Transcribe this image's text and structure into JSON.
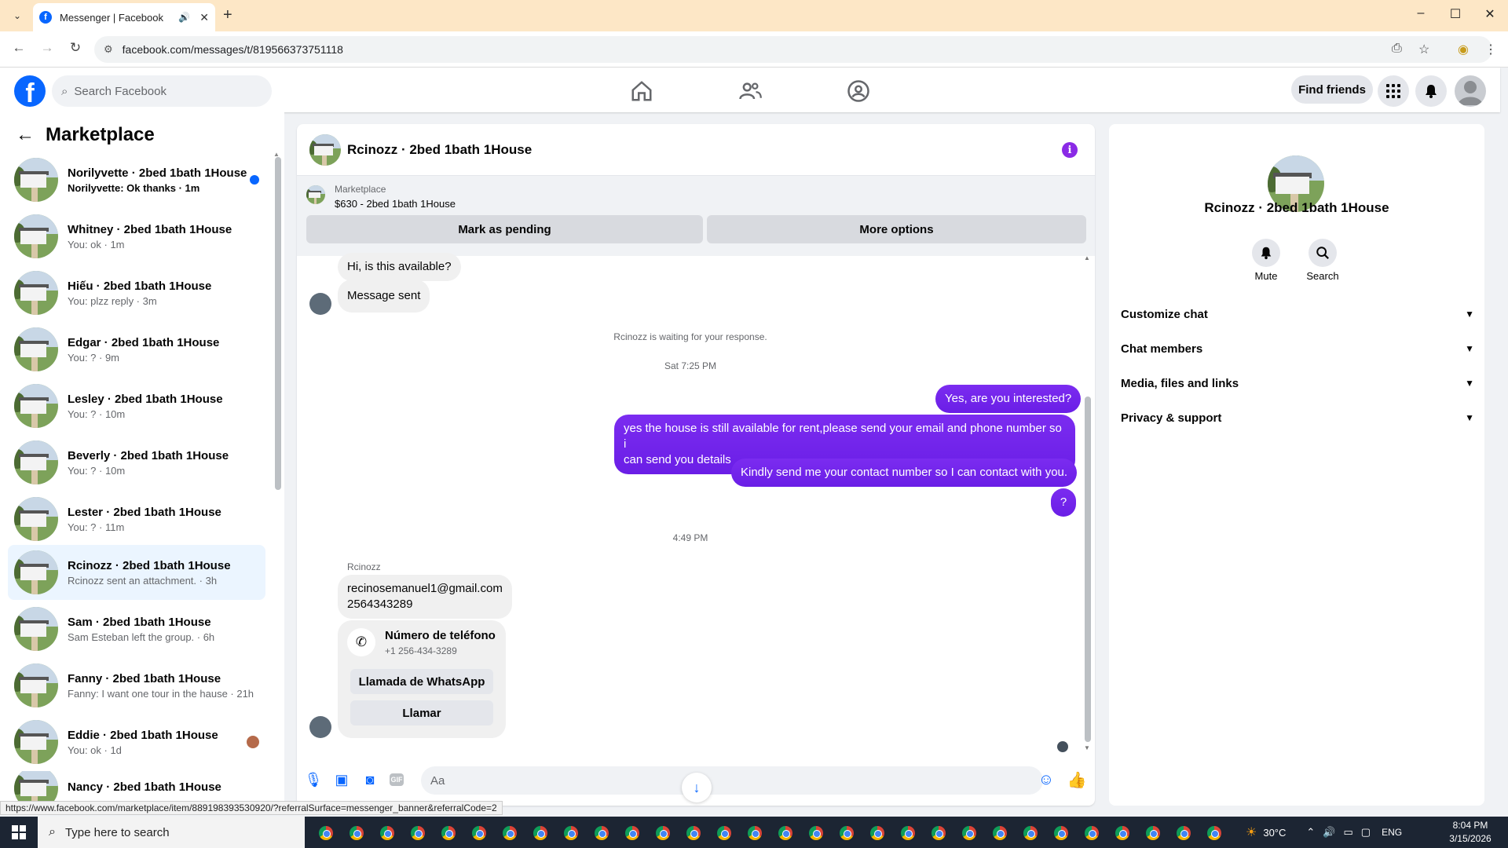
{
  "browser": {
    "tab_title": "Messenger | Facebook",
    "tabs_dropdown": "⌄",
    "new_tab": "+",
    "url": "facebook.com/messages/t/819566373751118",
    "minimize": "–",
    "maximize": "☐",
    "close": "✕",
    "back": "←",
    "forward": "→",
    "reload": "↻"
  },
  "fb_header": {
    "logo": "f",
    "search_placeholder": "Search Facebook",
    "find_friends": "Find friends"
  },
  "sidebar": {
    "title": "Marketplace",
    "back": "←",
    "conversations": [
      {
        "name": "Norilyvette · 2bed 1bath 1House",
        "preview": "Norilyvette: Ok thanks · 1m",
        "unread": true
      },
      {
        "name": "Whitney · 2bed 1bath 1House",
        "preview": "You: ok · 1m"
      },
      {
        "name": "Hiếu · 2bed 1bath 1House",
        "preview": "You: plzz reply · 3m"
      },
      {
        "name": "Edgar · 2bed 1bath 1House",
        "preview": "You: ? · 9m"
      },
      {
        "name": "Lesley · 2bed 1bath 1House",
        "preview": "You: ? · 10m"
      },
      {
        "name": "Beverly · 2bed 1bath 1House",
        "preview": "You: ? · 10m"
      },
      {
        "name": "Lester · 2bed 1bath 1House",
        "preview": "You: ? · 11m"
      },
      {
        "name": "Rcinozz · 2bed 1bath 1House",
        "preview": "Rcinozz sent an attachment. · 3h",
        "active": true
      },
      {
        "name": "Sam · 2bed 1bath 1House",
        "preview": "Sam Esteban left the group. · 6h"
      },
      {
        "name": "Fanny · 2bed 1bath 1House",
        "preview": "Fanny: I want one tour in the hause · 21h"
      },
      {
        "name": "Eddie · 2bed 1bath 1House",
        "preview": "You: ok · 1d"
      },
      {
        "name": "Nancy · 2bed 1bath 1House",
        "preview": ""
      }
    ]
  },
  "chat": {
    "title": "Rcinozz · 2bed 1bath 1House",
    "info": "i",
    "marketplace_label": "Marketplace",
    "listing": "$630 - 2bed 1bath 1House",
    "mark_pending": "Mark as pending",
    "more_options": "More options",
    "msg1": "Hi, is this available?",
    "msg2": "Message sent",
    "waiting": "Rcinozz is waiting for your response.",
    "time1": "Sat 7:25 PM",
    "out1": "Yes, are you interested?",
    "out2_line1": "yes the house is still available for rent,please send your email and phone number so i",
    "out2_line2": "can send you details",
    "out3": "Kindly send me your contact number so I can contact with you.",
    "out4": "?",
    "time2": "4:49 PM",
    "sender": "Rcinozz",
    "email": "recinosemanuel1@gmail.com",
    "phone_text": "2564343289",
    "card_title": "Número de teléfono",
    "card_number": "+1 256-434-3289",
    "whatsapp_btn": "Llamada de WhatsApp",
    "call_btn": "Llamar",
    "input_placeholder": "Aa"
  },
  "right_panel": {
    "name": "Rcinozz · 2bed 1bath 1House",
    "mute": "Mute",
    "search": "Search",
    "sections": [
      "Customize chat",
      "Chat members",
      "Media, files and links",
      "Privacy & support"
    ]
  },
  "status_url": "https://www.facebook.com/marketplace/item/889198393530920/?referralSurface=messenger_banner&referralCode=2",
  "taskbar": {
    "search_placeholder": "Type here to search",
    "temperature": "30°C",
    "language": "ENG",
    "time": "8:04 PM",
    "date": "3/15/2026"
  },
  "colors": {
    "brand": "#0866ff",
    "bubble_out": "#7a1ae8",
    "active_row": "#ebf5ff"
  }
}
